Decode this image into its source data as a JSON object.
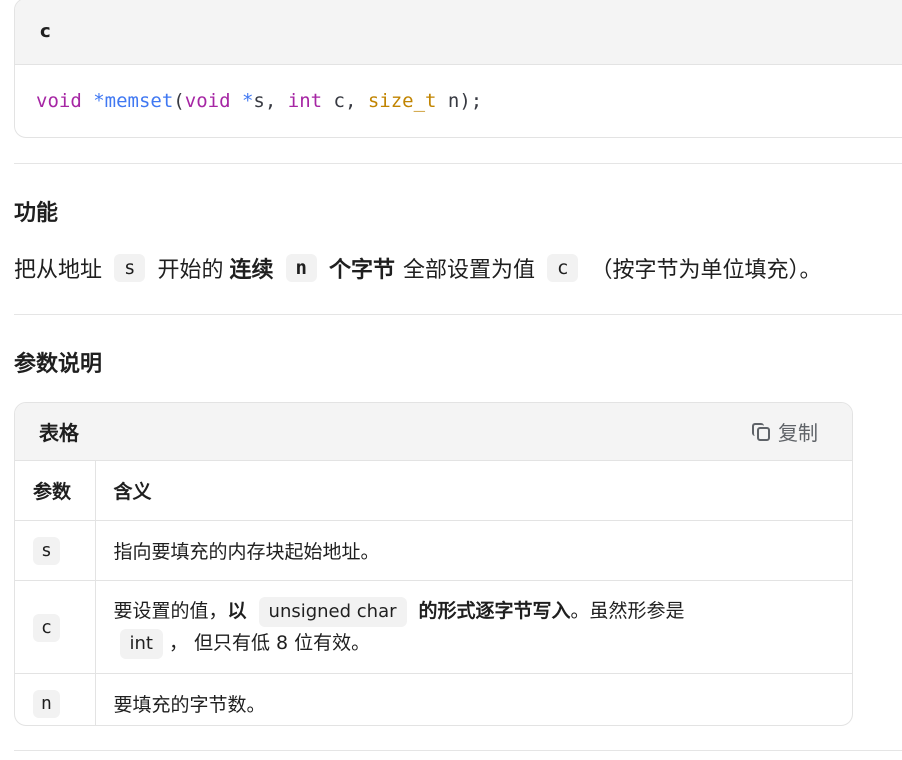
{
  "code": {
    "language": "c",
    "tokens": {
      "t1": "void",
      "t2": " ",
      "t3": "*memset",
      "t4": "(",
      "t5": "void",
      "t6": " ",
      "t7": "*",
      "t8": "s, ",
      "t9": "int",
      "t10": " c, ",
      "t11": "size_t",
      "t12": " n);"
    }
  },
  "function_section": {
    "heading": "功能",
    "parts": {
      "p1": "把从地址",
      "c1": "s",
      "p2": "开始的",
      "b1": "连续",
      "c2": "n",
      "b2": "个字节",
      "p3": "全部设置为值",
      "c3": "c",
      "p4": "（按字节为单位填充）。"
    }
  },
  "params_section": {
    "heading": "参数说明",
    "table": {
      "title": "表格",
      "copy_label": "复制",
      "header": {
        "param": "参数",
        "meaning": "含义"
      },
      "rows": {
        "r1": {
          "param": "s",
          "meaning": "指向要填充的内存块起始地址。"
        },
        "r2": {
          "param": "c",
          "m1": "要设置的值，",
          "m2": "以",
          "m3": "unsigned char",
          "m4": "的形式逐字节写入",
          "m5": "。虽然形参是",
          "m6": "int",
          "m7": "， 但只有低 8 位有效。"
        },
        "r3": {
          "param": "n",
          "meaning": "要填充的字节数。"
        }
      }
    }
  }
}
